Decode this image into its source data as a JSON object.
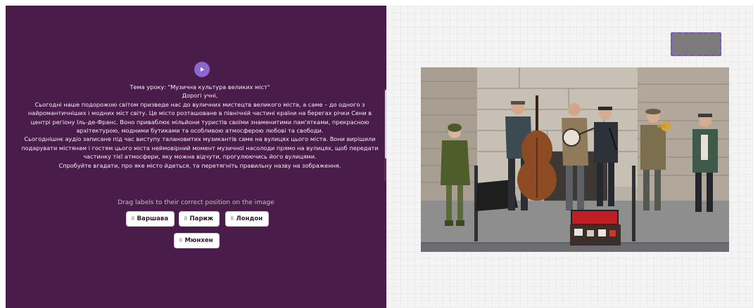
{
  "audio": {
    "play_icon": "play-icon"
  },
  "lesson": {
    "topic": "Тема уроку: \"Музична культура великих міст\"",
    "greeting": "Дорогі учні,",
    "paragraph1": "Сьогодні наше подорожою світом призведе нас до вуличних мистецтв великого міста, а саме – до одного з найромантичніших і модних міст світу. Це місто розташоване в північній частині країни на берегах річки Сени в центрі регіону Іль-де-Франс. Воно приваблює мільйони туристів своїми знаменитими пам'ятками, прекрасною архітектурою, модними бутиками та особливою атмосферою любові та свободи.",
    "paragraph2": "Сьогоднішнє аудіо записане під час виступу талановитих музикантів саме на вулицях цього міста. Вони вирішили подарувати містянам і гостям цього міста неймовірний момент музичної насолоди прямо на вулицях, щоб передати частинку тієї атмосфери, яку можна відчути, прогулюючись його вулицями.",
    "paragraph3": "Спробуйте вгадати, про яке місто йдеться, та перетягніть правильну назву на зображення."
  },
  "drag": {
    "instruction": "Drag labels to their correct position on the image",
    "labels": [
      "Варшава",
      "Париж",
      "Лондон",
      "Мюнхен"
    ],
    "handle_icon": "drag-handle-icon"
  },
  "colors": {
    "panel_bg": "#4a1c49",
    "accent": "#8a67d1",
    "drop_zone": "#7b7b7b",
    "drop_zone_border": "#7b54c9"
  }
}
